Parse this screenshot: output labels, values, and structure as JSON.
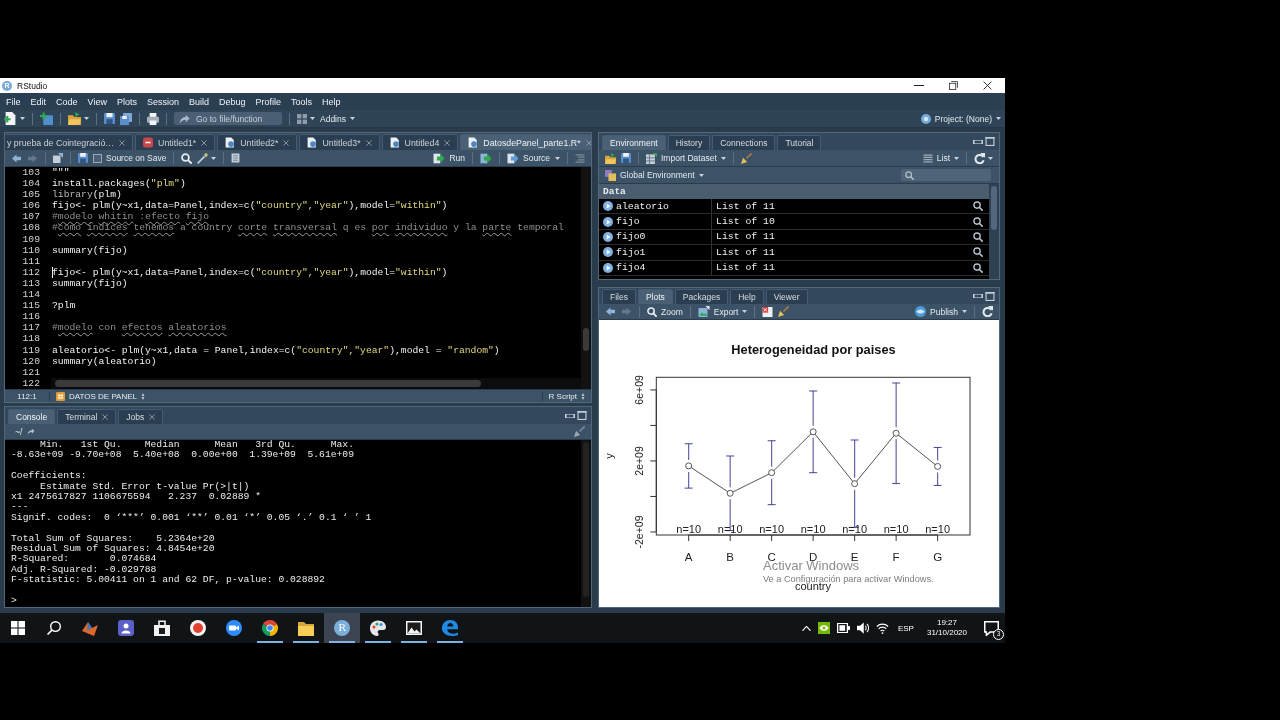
{
  "window": {
    "logo": "R",
    "title": "RStudio"
  },
  "menu": [
    "File",
    "Edit",
    "Code",
    "View",
    "Plots",
    "Session",
    "Build",
    "Debug",
    "Profile",
    "Tools",
    "Help"
  ],
  "toolbar": {
    "goto_placeholder": "Go to file/function",
    "addins": "Addins",
    "project": "Project: (None)"
  },
  "editor": {
    "tabs": [
      {
        "label": "y prueba de Cointegració…",
        "kind": "none",
        "selected": false
      },
      {
        "label": "Untitled1*",
        "kind": "rmd",
        "selected": false
      },
      {
        "label": "Untitled2*",
        "kind": "script",
        "selected": false
      },
      {
        "label": "Untitled3*",
        "kind": "script",
        "selected": false
      },
      {
        "label": "Untitled4",
        "kind": "script",
        "selected": false
      },
      {
        "label": "DatosdePanel_parte1.R*",
        "kind": "script",
        "selected": true
      }
    ],
    "source_on_save": {
      "label": "Source on Save",
      "checked": false
    },
    "run": "Run",
    "source": "Source",
    "lines": [
      {
        "number": "103",
        "cursor": false,
        "tokens": [
          {
            "text": "\"\"\"",
            "kind": "plain"
          }
        ]
      },
      {
        "number": "104",
        "cursor": false,
        "tokens": [
          {
            "text": "install.packages(",
            "kind": "plain"
          },
          {
            "text": "\"plm\"",
            "kind": "string"
          },
          {
            "text": ")",
            "kind": "plain"
          }
        ]
      },
      {
        "number": "105",
        "cursor": false,
        "tokens": [
          {
            "text": "library",
            "kind": "keyword"
          },
          {
            "text": "(plm)",
            "kind": "plain"
          }
        ]
      },
      {
        "number": "106",
        "cursor": false,
        "tokens": [
          {
            "text": "fijo<- plm(y~x1,data=Panel,index=c(",
            "kind": "plain"
          },
          {
            "text": "\"country\",\"year\"",
            "kind": "string"
          },
          {
            "text": "),model=",
            "kind": "plain"
          },
          {
            "text": "\"within\"",
            "kind": "string"
          },
          {
            "text": ")",
            "kind": "plain"
          }
        ]
      },
      {
        "number": "107",
        "cursor": false,
        "tokens": [
          {
            "text": "#",
            "kind": "comment"
          },
          {
            "text": "modelo",
            "kind": "flagged"
          },
          {
            "text": " whitin",
            "kind": "flagged"
          },
          {
            "text": " :",
            "kind": "comment"
          },
          {
            "text": "efecto",
            "kind": "flagged"
          },
          {
            "text": " fijo",
            "kind": "flagged"
          }
        ]
      },
      {
        "number": "108",
        "cursor": false,
        "tokens": [
          {
            "text": "#",
            "kind": "comment"
          },
          {
            "text": "como",
            "kind": "flagged"
          },
          {
            "text": " indices",
            "kind": "flagged"
          },
          {
            "text": " tenemos",
            "kind": "flagged"
          },
          {
            "text": " a country ",
            "kind": "comment"
          },
          {
            "text": "corte",
            "kind": "flagged"
          },
          {
            "text": " transversal",
            "kind": "flagged"
          },
          {
            "text": " q es ",
            "kind": "comment"
          },
          {
            "text": "por",
            "kind": "flagged"
          },
          {
            "text": " individuo",
            "kind": "flagged"
          },
          {
            "text": " y la ",
            "kind": "comment"
          },
          {
            "text": "parte",
            "kind": "flagged"
          },
          {
            "text": " temporal",
            "kind": "comment"
          }
        ]
      },
      {
        "number": "109",
        "cursor": false
      },
      {
        "number": "110",
        "cursor": false,
        "tokens": [
          {
            "text": "summary(fijo)",
            "kind": "plain"
          }
        ]
      },
      {
        "number": "111",
        "cursor": false
      },
      {
        "number": "112",
        "cursor": true,
        "tokens": [
          {
            "text": "fijo<- plm(y~x1,data=Panel,index=c(",
            "kind": "plain"
          },
          {
            "text": "\"country\",\"year\"",
            "kind": "string"
          },
          {
            "text": "),model=",
            "kind": "plain"
          },
          {
            "text": "\"within\"",
            "kind": "string"
          },
          {
            "text": ")",
            "kind": "plain"
          }
        ]
      },
      {
        "number": "113",
        "cursor": false,
        "tokens": [
          {
            "text": "summary(fijo)",
            "kind": "plain"
          }
        ]
      },
      {
        "number": "114",
        "cursor": false
      },
      {
        "number": "115",
        "cursor": false,
        "tokens": [
          {
            "text": "?plm",
            "kind": "plain"
          }
        ]
      },
      {
        "number": "116",
        "cursor": false
      },
      {
        "number": "117",
        "cursor": false,
        "tokens": [
          {
            "text": "#",
            "kind": "comment"
          },
          {
            "text": "modelo",
            "kind": "flagged"
          },
          {
            "text": " con ",
            "kind": "comment"
          },
          {
            "text": "efectos",
            "kind": "flagged"
          },
          {
            "text": " aleatorios",
            "kind": "flagged"
          }
        ]
      },
      {
        "number": "118",
        "cursor": false
      },
      {
        "number": "119",
        "cursor": false,
        "tokens": [
          {
            "text": "aleatorio<- plm(y~x1,data = Panel,index=c(",
            "kind": "plain"
          },
          {
            "text": "\"country\",\"year\"",
            "kind": "string"
          },
          {
            "text": "),model = ",
            "kind": "plain"
          },
          {
            "text": "\"random\"",
            "kind": "string"
          },
          {
            "text": ")",
            "kind": "plain"
          }
        ]
      },
      {
        "number": "120",
        "cursor": false,
        "tokens": [
          {
            "text": "summary(aleatorio)",
            "kind": "plain"
          }
        ]
      },
      {
        "number": "121",
        "cursor": false
      },
      {
        "number": "122",
        "cursor": false
      }
    ],
    "status": {
      "position": "112:1",
      "section": "DATOS DE PANEL",
      "file_type": "R Script"
    }
  },
  "console": {
    "tabs": [
      {
        "label": "Console",
        "selected": true,
        "closable": false
      },
      {
        "label": "Terminal",
        "selected": false,
        "closable": true
      },
      {
        "label": "Jobs",
        "selected": false,
        "closable": true
      }
    ],
    "path": "~/",
    "output": [
      [
        "     Min.   1st Qu.    Median      Mean   3rd Qu.      Max.",
        "-8.63e+09 -9.70e+08  5.40e+08  0.00e+00  1.39e+09  5.61e+09"
      ],
      [
        "Coefficients:",
        "     Estimate Std. Error t-value Pr(>|t|)",
        "x1 2475617827 1106675594   2.237  0.02889 *",
        "---",
        "Signif. codes:  0 ‘***’ 0.001 ‘**’ 0.01 ‘*’ 0.05 ‘.’ 0.1 ‘ ’ 1"
      ],
      [
        "Total Sum of Squares:    5.2364e+20",
        "Residual Sum of Squares: 4.8454e+20",
        "R-Squared:       0.074684",
        "Adj. R-Squared: -0.029788",
        "F-statistic: 5.00411 on 1 and 62 DF, p-value: 0.028892"
      ]
    ],
    "prompt": ">"
  },
  "environment": {
    "tabs": [
      {
        "label": "Environment",
        "selected": true
      },
      {
        "label": "History",
        "selected": false
      },
      {
        "label": "Connections",
        "selected": false
      },
      {
        "label": "Tutorial",
        "selected": false
      }
    ],
    "import": "Import Dataset",
    "view": "List",
    "scope": "Global Environment",
    "section": "Data",
    "rows": [
      {
        "name": "aleatorio",
        "value": "List of 11"
      },
      {
        "name": "fijo",
        "value": "List of 10"
      },
      {
        "name": "fijo0",
        "value": "List of 11"
      },
      {
        "name": "fijo1",
        "value": "List of 11"
      },
      {
        "name": "fijo4",
        "value": "List of 11"
      }
    ]
  },
  "plots": {
    "tabs": [
      {
        "label": "Files",
        "selected": false
      },
      {
        "label": "Plots",
        "selected": true
      },
      {
        "label": "Packages",
        "selected": false
      },
      {
        "label": "Help",
        "selected": false
      },
      {
        "label": "Viewer",
        "selected": false
      }
    ],
    "zoom": "Zoom",
    "export": "Export",
    "publish": "Publish",
    "chart_data": {
      "type": "line",
      "title": "Heterogeneidad por paises",
      "xlabel": "country",
      "ylabel": "y",
      "categories": [
        "A",
        "B",
        "C",
        "D",
        "E",
        "F",
        "G"
      ],
      "values": [
        1720000000,
        180000000,
        1340000000,
        3640000000,
        720000000,
        3560000000,
        1690000000
      ],
      "errors": [
        1250000000,
        2100000000,
        1800000000,
        2300000000,
        2460000000,
        2830000000,
        1070000000
      ],
      "marker": "circle",
      "ylim": [
        -2170000000,
        6710000000
      ],
      "yticks": [
        {
          "value": -2000000000,
          "label": "-2e+09"
        },
        {
          "value": 2000000000,
          "label": "2e+09"
        },
        {
          "value": 6000000000,
          "label": "6e+09"
        }
      ],
      "annotations": [
        "n=10",
        "n=10",
        "n=10",
        "n=10",
        "n=10",
        "n=10",
        "n=10"
      ]
    }
  },
  "activation_notice": {
    "title": "Activar Windows",
    "text": "Ve a Configuración para activar Windows."
  },
  "taskbar": {
    "apps": [
      {
        "kind": "peak",
        "running": false,
        "selected": false
      },
      {
        "kind": "people",
        "running": false,
        "selected": false
      },
      {
        "kind": "bag",
        "running": false,
        "selected": false
      },
      {
        "kind": "record",
        "running": false,
        "selected": false
      },
      {
        "kind": "camera",
        "running": false,
        "selected": false
      },
      {
        "kind": "browser",
        "running": true,
        "selected": false
      },
      {
        "kind": "folder",
        "running": true,
        "selected": false
      },
      {
        "kind": "r",
        "label": "R",
        "running": true,
        "selected": true
      },
      {
        "kind": "palette",
        "running": true,
        "selected": false
      },
      {
        "kind": "picture",
        "running": true,
        "selected": false
      },
      {
        "kind": "swirl",
        "running": true,
        "selected": false
      }
    ],
    "language": "ESP",
    "time": "19:27",
    "date": "31/10/2020",
    "notifications": "3"
  }
}
